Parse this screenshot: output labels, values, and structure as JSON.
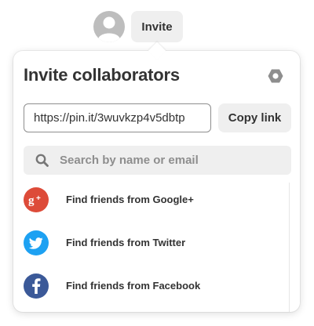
{
  "header": {
    "invite_label": "Invite"
  },
  "popover": {
    "title": "Invite collaborators",
    "link_value": "https://pin.it/3wuvkzp4v5dbtp",
    "copy_link_label": "Copy link",
    "search_placeholder": "Search by name or email"
  },
  "friends": [
    {
      "label": "Find friends from Google+",
      "icon": "google-plus-icon",
      "color": "#dd4b39",
      "glyph": "g+"
    },
    {
      "label": "Find friends from Twitter",
      "icon": "twitter-icon",
      "color": "#1da1f2",
      "glyph": "bird"
    },
    {
      "label": "Find friends from Facebook",
      "icon": "facebook-icon",
      "color": "#3b5998",
      "glyph": "f"
    }
  ],
  "colors": {
    "button_bg": "#efefef",
    "text": "#333333",
    "placeholder": "#8e8e8e"
  }
}
